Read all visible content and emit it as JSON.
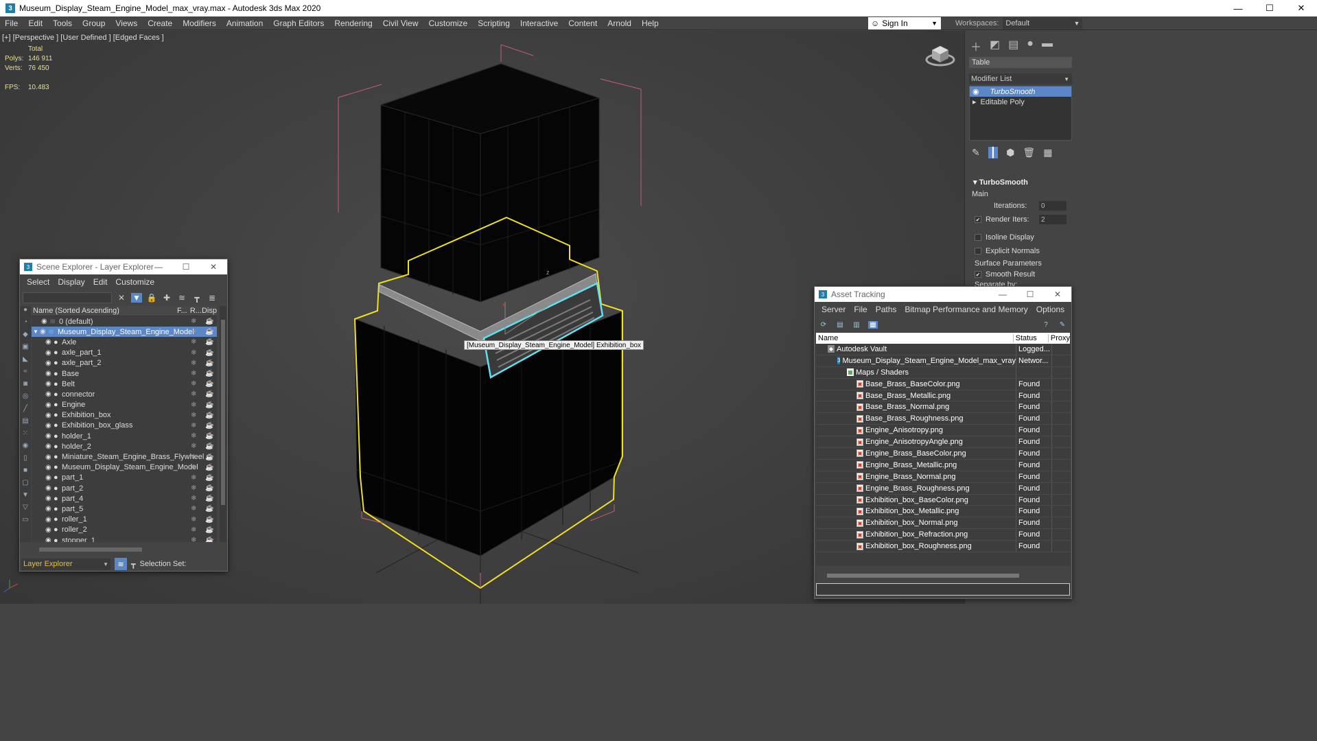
{
  "window": {
    "title": "Museum_Display_Steam_Engine_Model_max_vray.max - Autodesk 3ds Max 2020",
    "app_icon": "3",
    "minimize": "—",
    "maximize": "☐",
    "close": "✕"
  },
  "menu": [
    "File",
    "Edit",
    "Tools",
    "Group",
    "Views",
    "Create",
    "Modifiers",
    "Animation",
    "Graph Editors",
    "Rendering",
    "Civil View",
    "Customize",
    "Scripting",
    "Interactive",
    "Content",
    "Arnold",
    "Help"
  ],
  "signin": {
    "label": "Sign In",
    "caret": "▼"
  },
  "workspaces": {
    "label": "Workspaces:",
    "value": "Default"
  },
  "viewport": {
    "label": "[+] [Perspective ] [User Defined ] [Edged Faces ]",
    "stats_header": "Total",
    "polys_label": "Polys:",
    "polys_value": "146 911",
    "verts_label": "Verts:",
    "verts_value": "76 450",
    "fps_label": "FPS:",
    "fps_value": "10.483",
    "tooltip": "[Museum_Display_Steam_Engine_Model] Exhibition_box",
    "axis_z": "z",
    "axis_x": "x"
  },
  "command_panel": {
    "object_name": "Table",
    "modifier_list": "Modifier List",
    "stack": [
      "TurboSmooth",
      "Editable Poly"
    ],
    "rollout_title": "TurboSmooth",
    "main_label": "Main",
    "iterations_label": "Iterations:",
    "iterations_value": "0",
    "render_iters_label": "Render Iters:",
    "render_iters_value": "2",
    "isoline_label": "Isoline Display",
    "explicit_normals_label": "Explicit Normals",
    "surface_params_label": "Surface Parameters",
    "smooth_result_label": "Smooth Result",
    "separate_by_label": "Separate by:"
  },
  "scene_explorer": {
    "title": "Scene Explorer - Layer Explorer",
    "menu": [
      "Select",
      "Display",
      "Edit",
      "Customize"
    ],
    "col_name": "Name (Sorted Ascending)",
    "col_f": "F...",
    "col_r": "R...",
    "col_d": "Disp",
    "rows": [
      {
        "name": "0 (default)",
        "indent": 1,
        "sel": false
      },
      {
        "name": "Museum_Display_Steam_Engine_Model",
        "indent": 0,
        "sel": true
      },
      {
        "name": "Axle",
        "indent": 2,
        "sel": false
      },
      {
        "name": "axle_part_1",
        "indent": 2,
        "sel": false
      },
      {
        "name": "axle_part_2",
        "indent": 2,
        "sel": false
      },
      {
        "name": "Base",
        "indent": 2,
        "sel": false
      },
      {
        "name": "Belt",
        "indent": 2,
        "sel": false
      },
      {
        "name": "connector",
        "indent": 2,
        "sel": false
      },
      {
        "name": "Engine",
        "indent": 2,
        "sel": false
      },
      {
        "name": "Exhibition_box",
        "indent": 2,
        "sel": false
      },
      {
        "name": "Exhibition_box_glass",
        "indent": 2,
        "sel": false
      },
      {
        "name": "holder_1",
        "indent": 2,
        "sel": false
      },
      {
        "name": "holder_2",
        "indent": 2,
        "sel": false
      },
      {
        "name": "Miniature_Steam_Engine_Brass_Flywheel",
        "indent": 2,
        "sel": false
      },
      {
        "name": "Museum_Display_Steam_Engine_Model",
        "indent": 2,
        "sel": false
      },
      {
        "name": "part_1",
        "indent": 2,
        "sel": false
      },
      {
        "name": "part_2",
        "indent": 2,
        "sel": false
      },
      {
        "name": "part_4",
        "indent": 2,
        "sel": false
      },
      {
        "name": "part_5",
        "indent": 2,
        "sel": false
      },
      {
        "name": "roller_1",
        "indent": 2,
        "sel": false
      },
      {
        "name": "roller_2",
        "indent": 2,
        "sel": false
      },
      {
        "name": "stopper_1",
        "indent": 2,
        "sel": false
      }
    ],
    "layer_dropdown": "Layer Explorer",
    "selection_set_label": "Selection Set:"
  },
  "asset_tracking": {
    "title": "Asset Tracking",
    "menu": [
      "Server",
      "File",
      "Paths",
      "Bitmap Performance and Memory",
      "Options"
    ],
    "col_name": "Name",
    "col_status": "Status",
    "col_proxy": "Proxy",
    "rows": [
      {
        "name": "Autodesk Vault",
        "status": "Logged...",
        "icon": "vault",
        "indent": 1
      },
      {
        "name": "Museum_Display_Steam_Engine_Model_max_vray.max",
        "status": "Networ...",
        "icon": "max",
        "indent": 2
      },
      {
        "name": "Maps / Shaders",
        "status": "",
        "icon": "folder",
        "indent": 3
      },
      {
        "name": "Base_Brass_BaseColor.png",
        "status": "Found",
        "icon": "img",
        "indent": 4
      },
      {
        "name": "Base_Brass_Metallic.png",
        "status": "Found",
        "icon": "img",
        "indent": 4
      },
      {
        "name": "Base_Brass_Normal.png",
        "status": "Found",
        "icon": "img",
        "indent": 4
      },
      {
        "name": "Base_Brass_Roughness.png",
        "status": "Found",
        "icon": "img",
        "indent": 4
      },
      {
        "name": "Engine_Anisotropy.png",
        "status": "Found",
        "icon": "img",
        "indent": 4
      },
      {
        "name": "Engine_AnisotropyAngle.png",
        "status": "Found",
        "icon": "img",
        "indent": 4
      },
      {
        "name": "Engine_Brass_BaseColor.png",
        "status": "Found",
        "icon": "img",
        "indent": 4
      },
      {
        "name": "Engine_Brass_Metallic.png",
        "status": "Found",
        "icon": "img",
        "indent": 4
      },
      {
        "name": "Engine_Brass_Normal.png",
        "status": "Found",
        "icon": "img",
        "indent": 4
      },
      {
        "name": "Engine_Brass_Roughness.png",
        "status": "Found",
        "icon": "img",
        "indent": 4
      },
      {
        "name": "Exhibition_box_BaseColor.png",
        "status": "Found",
        "icon": "img",
        "indent": 4
      },
      {
        "name": "Exhibition_box_Metallic.png",
        "status": "Found",
        "icon": "img",
        "indent": 4
      },
      {
        "name": "Exhibition_box_Normal.png",
        "status": "Found",
        "icon": "img",
        "indent": 4
      },
      {
        "name": "Exhibition_box_Refraction.png",
        "status": "Found",
        "icon": "img",
        "indent": 4
      },
      {
        "name": "Exhibition_box_Roughness.png",
        "status": "Found",
        "icon": "img",
        "indent": 4
      }
    ]
  },
  "colors": {
    "selection_blue": "#5b87c6",
    "selection_yellow": "#f0e020",
    "bbox_pink": "#d06080",
    "glass_cyan": "#60e0f0"
  }
}
